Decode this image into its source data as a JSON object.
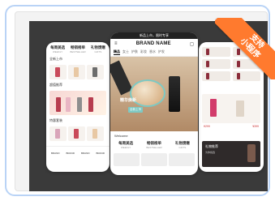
{
  "ribbon": {
    "line1": "支持",
    "line2": "小程序"
  },
  "left_phone": {
    "categories": [
      {
        "cn": "每周美选",
        "sub": "WEEKLY"
      },
      {
        "cn": "畅销榜单",
        "sub": "BESTSELLER"
      },
      {
        "cn": "礼物馈赠",
        "sub": "GIFTS"
      }
    ],
    "section1": "全新上市",
    "section2": "超值推荐",
    "section3": "特惠套装",
    "brands": [
      "BRAND",
      "BRAND",
      "BRAND",
      "BRAND"
    ]
  },
  "center_phone": {
    "status_text": "新品上市，限时专享",
    "brand_name": "BRAND NAME",
    "tabs": [
      "精品",
      "女士",
      "护肤",
      "彩妆",
      "香水",
      "护发"
    ],
    "hero_caption": "精华焕新",
    "hero_tag": "全新上市",
    "welcome": "Welcome",
    "categories": [
      {
        "cn": "每周美选",
        "sub": "WEEKLY"
      },
      {
        "cn": "畅销榜单",
        "sub": "BESTSELLER"
      },
      {
        "cn": "礼物馈赠",
        "sub": "GIFTS"
      }
    ]
  },
  "right_phone": {
    "prices": [
      "¥299",
      "¥399"
    ],
    "bottom_title": "礼物推荐",
    "bottom_sub": "为你挑选"
  },
  "colors": {
    "accent": "#ff7a2e",
    "frame": "#b9d3f6"
  }
}
